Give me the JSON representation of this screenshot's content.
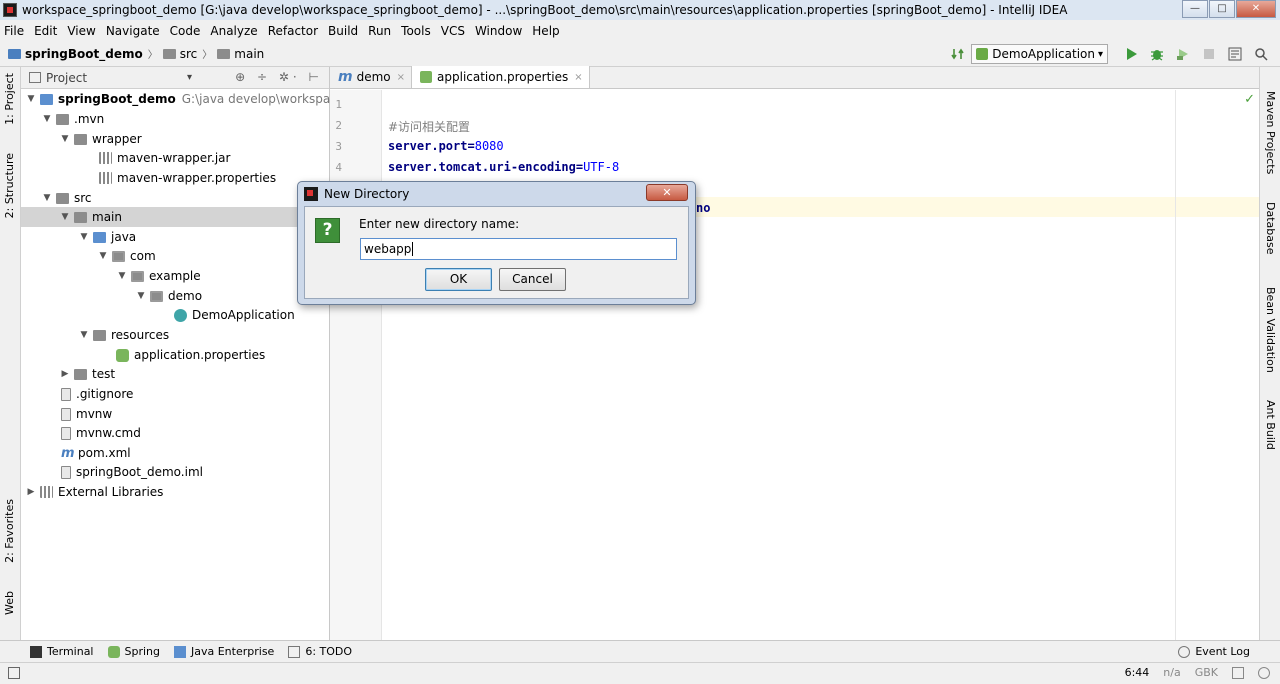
{
  "window": {
    "title": "workspace_springboot_demo [G:\\java develop\\workspace_springboot_demo] - ...\\springBoot_demo\\src\\main\\resources\\application.properties [springBoot_demo] - IntelliJ IDEA",
    "min": "—",
    "max": "□",
    "close": "✕"
  },
  "menu": [
    "File",
    "Edit",
    "View",
    "Navigate",
    "Code",
    "Analyze",
    "Refactor",
    "Build",
    "Run",
    "Tools",
    "VCS",
    "Window",
    "Help"
  ],
  "breadcrumb": {
    "project": "springBoot_demo",
    "src": "src",
    "main": "main"
  },
  "run_config": {
    "name": "DemoApplication",
    "arrow": "▾"
  },
  "left_tabs": {
    "project": "1: Project",
    "structure": "2: Structure",
    "favorites": "2: Favorites",
    "web": "Web"
  },
  "right_tabs": {
    "maven": "Maven Projects",
    "database": "Database",
    "bean": "Bean Validation",
    "ant": "Ant Build"
  },
  "project_panel": {
    "title": "Project",
    "dropdown": "▾",
    "icons": "⊕ ÷ ✲· ⊢",
    "tree": [
      {
        "label": "springBoot_demo",
        "path": "G:\\java develop\\workspace_sp"
      },
      {
        "label": ".mvn"
      },
      {
        "label": "wrapper"
      },
      {
        "label": "maven-wrapper.jar"
      },
      {
        "label": "maven-wrapper.properties"
      },
      {
        "label": "src"
      },
      {
        "label": "main"
      },
      {
        "label": "java"
      },
      {
        "label": "com"
      },
      {
        "label": "example"
      },
      {
        "label": "demo"
      },
      {
        "label": "DemoApplication"
      },
      {
        "label": "resources"
      },
      {
        "label": "application.properties"
      },
      {
        "label": "test"
      },
      {
        "label": ".gitignore"
      },
      {
        "label": "mvnw"
      },
      {
        "label": "mvnw.cmd"
      },
      {
        "label": "pom.xml"
      },
      {
        "label": "springBoot_demo.iml"
      },
      {
        "label": "External Libraries"
      }
    ]
  },
  "editor": {
    "tabs": [
      {
        "label": "demo",
        "close": "×"
      },
      {
        "label": "application.properties",
        "close": "×"
      }
    ],
    "line_numbers": [
      "1",
      "2",
      "3",
      "4"
    ],
    "code": {
      "comment": "#访问相关配置",
      "port_key": "server.port",
      "port_val": "8080",
      "enc_key": "server.tomcat.uri-encoding",
      "enc_val": "UTF-8",
      "partial": "no"
    },
    "check": "✓"
  },
  "bottom_tools": [
    "Terminal",
    "Spring",
    "Java Enterprise",
    "6: TODO"
  ],
  "event_log": "Event Log",
  "status": {
    "position": "6:44",
    "na": "n/a",
    "encoding": "GBK"
  },
  "dialog": {
    "title": "New Directory",
    "close": "✕",
    "question_mark": "?",
    "label": "Enter new directory name:",
    "value": "webapp",
    "ok": "OK",
    "cancel": "Cancel"
  }
}
